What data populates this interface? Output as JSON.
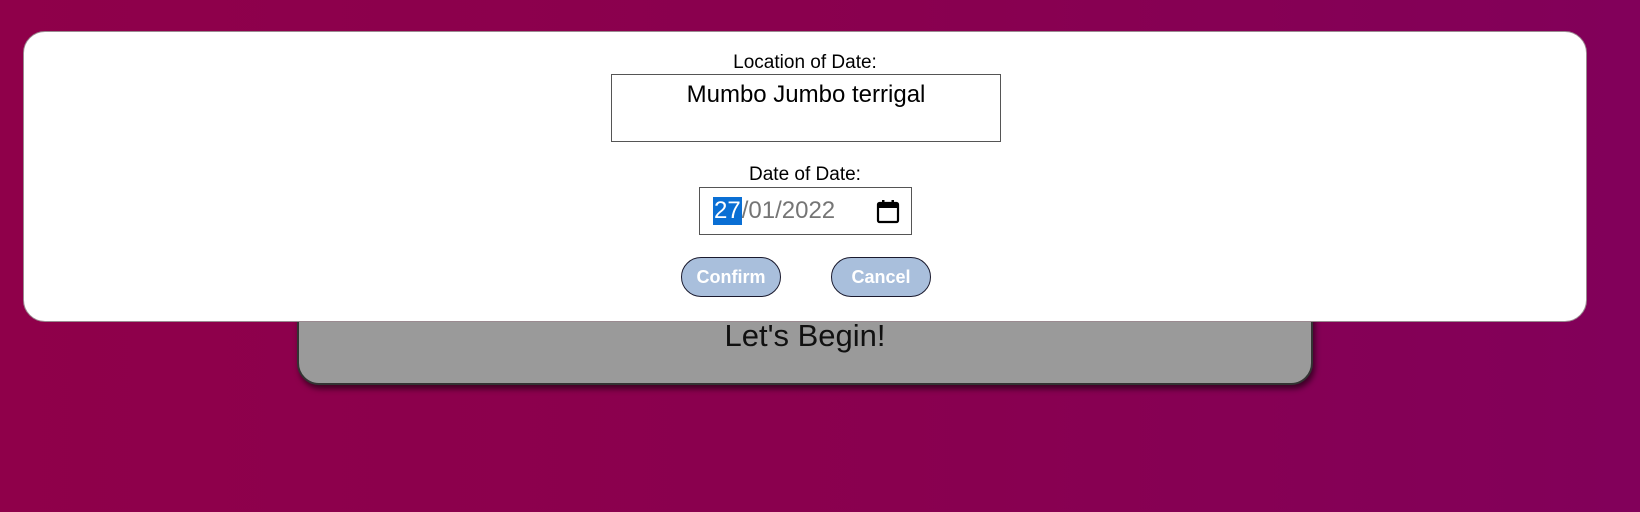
{
  "background_card": {
    "title": "Let's Begin!"
  },
  "modal": {
    "location_label": "Location of Date:",
    "location_value": "Mumbo Jumbo terrigal",
    "date_label": "Date of Date:",
    "date_day": "27",
    "date_month": "01",
    "date_year": "2022",
    "date_separator": "/",
    "confirm_label": "Confirm",
    "cancel_label": "Cancel"
  },
  "colors": {
    "background_gradient_start": "#8f004a",
    "background_gradient_end": "#82005a",
    "button_fill": "#a9bfdc",
    "selected_segment": "#0a6fd4",
    "card_fill": "#9a9a9a"
  },
  "icons": {
    "date_picker": "calendar-icon"
  }
}
